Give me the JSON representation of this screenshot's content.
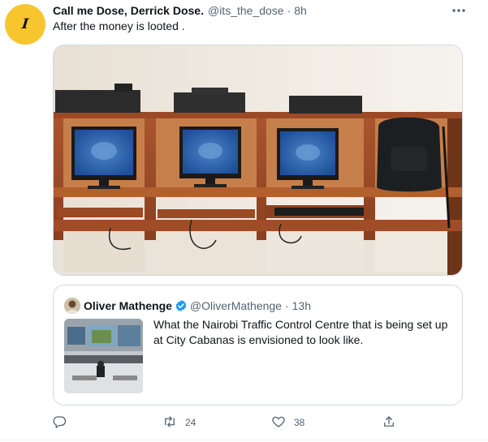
{
  "tweet": {
    "avatar_glyph": "I",
    "display_name": "Call me Dose, Derrick Dose.",
    "handle": "@its_the_dose",
    "separator": "·",
    "time": "8h",
    "more_icon": "more-dots-icon",
    "text": "After the money is looted ."
  },
  "quote": {
    "display_name": "Oliver Mathenge",
    "handle": "@OliverMathenge",
    "separator": "·",
    "time": "13h",
    "text": "What the Nairobi Traffic Control Centre that is being set up at City Cabanas is envisioned to look like.",
    "verified_icon": "verified-badge-icon"
  },
  "actions": {
    "reply": {
      "icon": "reply-icon",
      "count": ""
    },
    "retweet": {
      "icon": "retweet-icon",
      "count": "24"
    },
    "like": {
      "icon": "heart-icon",
      "count": "38"
    },
    "share": {
      "icon": "share-icon",
      "count": ""
    }
  },
  "colors": {
    "avatar_bg": "#f7c62f",
    "secondary_text": "#536471",
    "verified": "#1d9bf0",
    "border": "#cfd9de"
  }
}
